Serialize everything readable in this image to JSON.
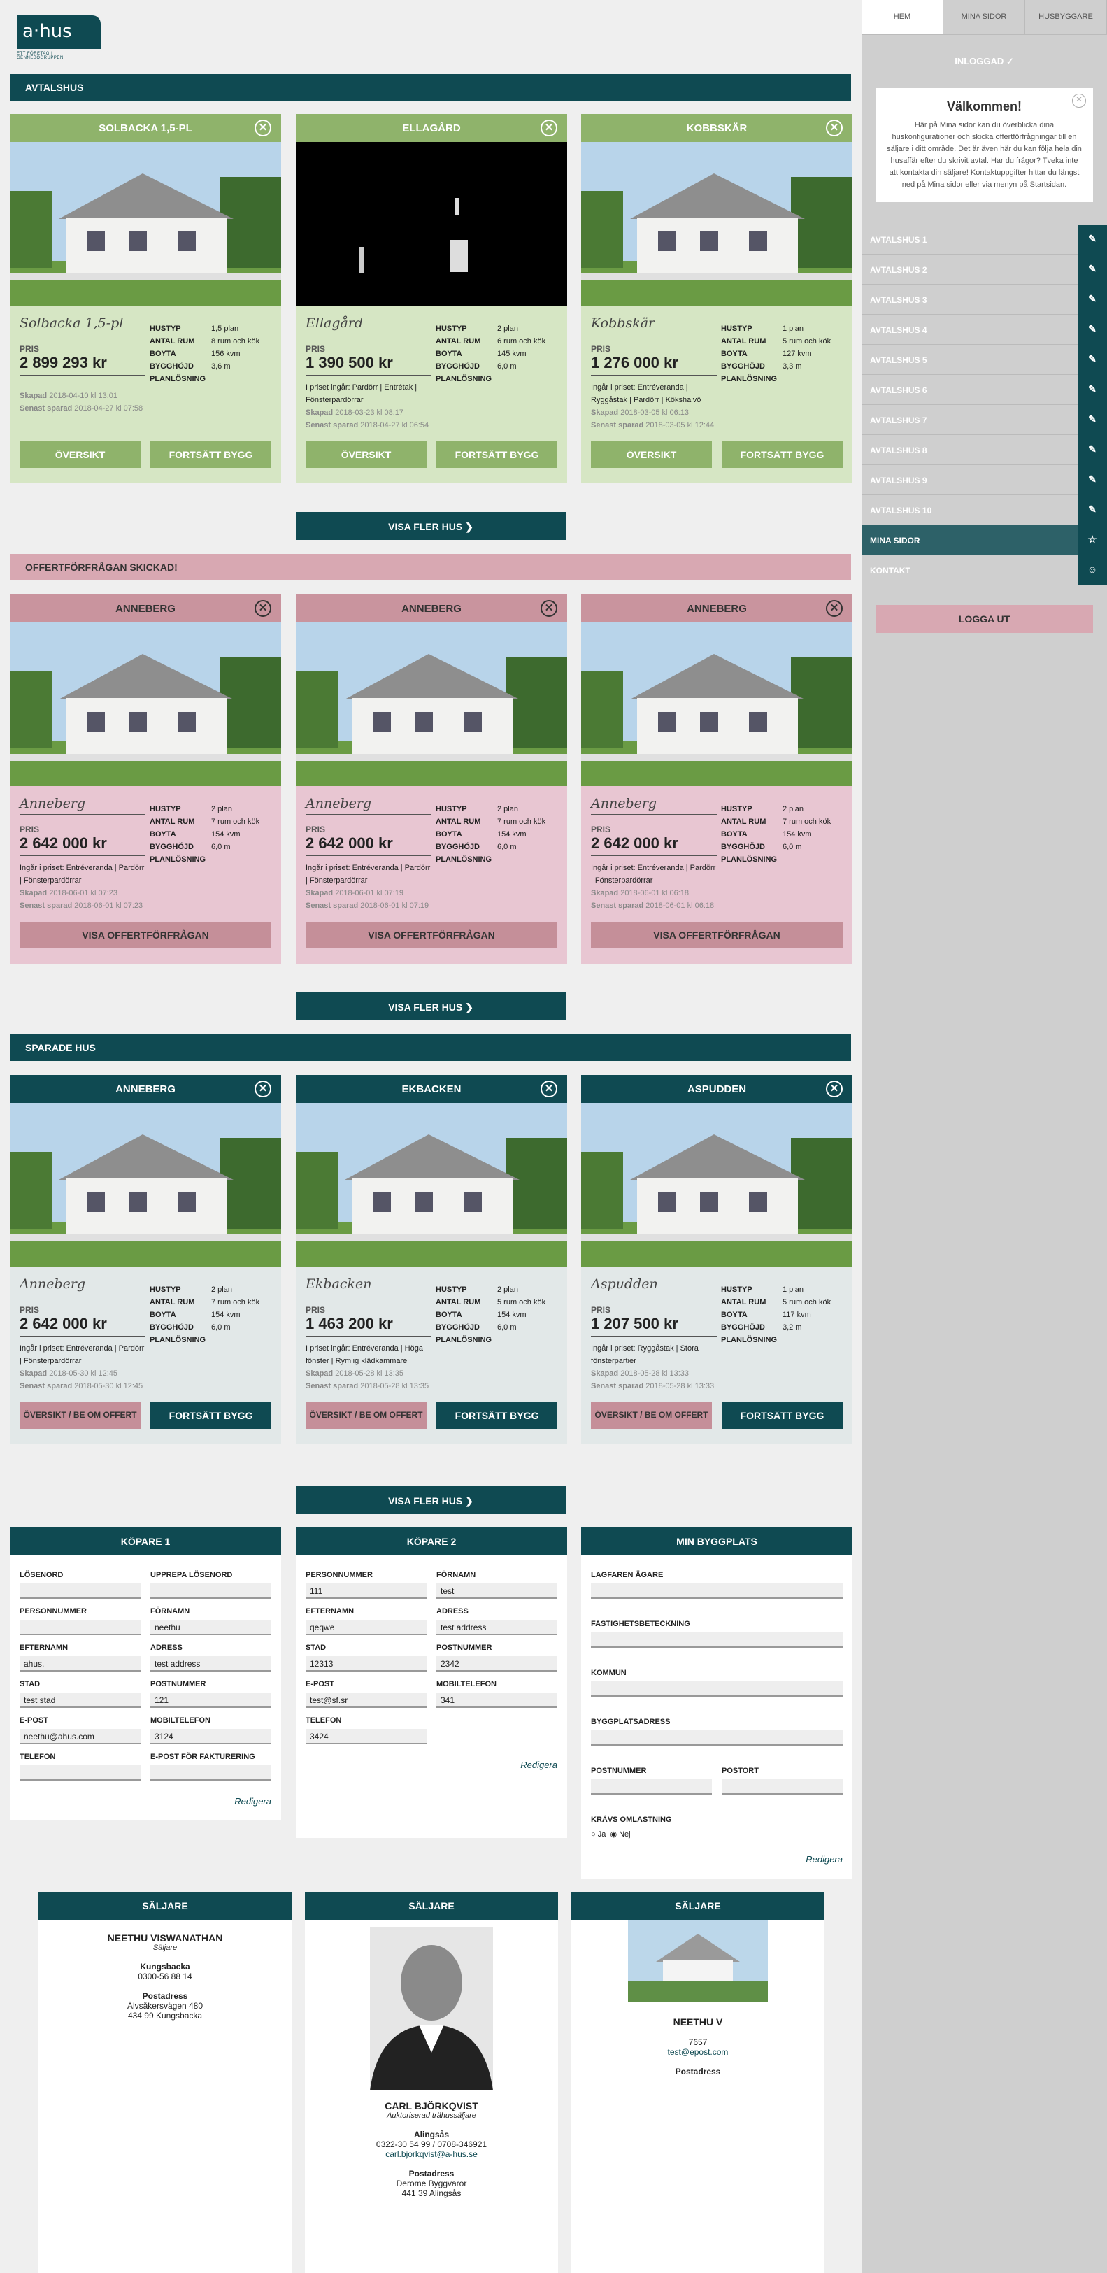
{
  "logo": {
    "brand": "a·hus",
    "tagline": "ETT FÖRETAG I GENNEBOGRUPPEN"
  },
  "sections": {
    "avtalshus": "AVTALSHUS",
    "offert": "OFFERTFÖRFRÅGAN SKICKAD!",
    "sparade": "SPARADE HUS",
    "more": "VISA FLER HUS ❯"
  },
  "labels": {
    "pris": "PRIS",
    "hustyp": "HUSTYP",
    "antal_rum": "ANTAL RUM",
    "boyta": "BOYTA",
    "bygghojd": "BYGGHÖJD",
    "planlosning": "PLANLÖSNING",
    "skapad": "Skapad",
    "senast": "Senast sparad"
  },
  "avtal": [
    {
      "title": "SOLBACKA 1,5-PL",
      "name": "Solbacka 1,5-pl",
      "price": "2 899 293 kr",
      "hustyp": "1,5 plan",
      "rum": "8 rum och kök",
      "boyta": "156 kvm",
      "hojd": "3,6 m",
      "incl": "",
      "skapad": "2018-04-10 kl 13:01",
      "senast": "2018-04-27 kl 07:58",
      "b1": "ÖVERSIKT",
      "b2": "FORTSÄTT BYGG"
    },
    {
      "title": "ELLAGÅRD",
      "name": "Ellagård",
      "price": "1 390 500 kr",
      "hustyp": "2 plan",
      "rum": "6 rum och kök",
      "boyta": "145 kvm",
      "hojd": "6,0 m",
      "incl": "I priset ingår: Pardörr | Entrétak | Fönsterpardörrar",
      "skapad": "2018-03-23 kl 08:17",
      "senast": "2018-04-27 kl 06:54",
      "b1": "ÖVERSIKT",
      "b2": "FORTSÄTT BYGG"
    },
    {
      "title": "KOBBSKÄR",
      "name": "Kobbskär",
      "price": "1 276 000 kr",
      "hustyp": "1 plan",
      "rum": "5 rum och kök",
      "boyta": "127 kvm",
      "hojd": "3,3 m",
      "incl": "Ingår i priset: Entréveranda | Ryggåstak | Pardörr | Kökshalvö",
      "skapad": "2018-03-05 kl 06:13",
      "senast": "2018-03-05 kl 12:44",
      "b1": "ÖVERSIKT",
      "b2": "FORTSÄTT BYGG"
    }
  ],
  "offert": [
    {
      "title": "ANNEBERG",
      "name": "Anneberg",
      "price": "2 642 000 kr",
      "hustyp": "2 plan",
      "rum": "7 rum och kök",
      "boyta": "154 kvm",
      "hojd": "6,0 m",
      "incl": "Ingår i priset: Entréveranda | Pardörr | Fönsterpardörrar",
      "skapad": "2018-06-01 kl 07:23",
      "senast": "2018-06-01 kl 07:23",
      "b1": "VISA OFFERTFÖRFRÅGAN"
    },
    {
      "title": "ANNEBERG",
      "name": "Anneberg",
      "price": "2 642 000 kr",
      "hustyp": "2 plan",
      "rum": "7 rum och kök",
      "boyta": "154 kvm",
      "hojd": "6,0 m",
      "incl": "Ingår i priset: Entréveranda | Pardörr | Fönsterpardörrar",
      "skapad": "2018-06-01 kl 07:19",
      "senast": "2018-06-01 kl 07:19",
      "b1": "VISA OFFERTFÖRFRÅGAN"
    },
    {
      "title": "ANNEBERG",
      "name": "Anneberg",
      "price": "2 642 000 kr",
      "hustyp": "2 plan",
      "rum": "7 rum och kök",
      "boyta": "154 kvm",
      "hojd": "6,0 m",
      "incl": "Ingår i priset: Entréveranda | Pardörr | Fönsterpardörrar",
      "skapad": "2018-06-01 kl 06:18",
      "senast": "2018-06-01 kl 06:18",
      "b1": "VISA OFFERTFÖRFRÅGAN"
    }
  ],
  "sparade": [
    {
      "title": "ANNEBERG",
      "name": "Anneberg",
      "price": "2 642 000 kr",
      "hustyp": "2 plan",
      "rum": "7 rum och kök",
      "boyta": "154 kvm",
      "hojd": "6,0 m",
      "incl": "Ingår i priset: Entréveranda | Pardörr | Fönsterpardörrar",
      "skapad": "2018-05-30 kl 12:45",
      "senast": "2018-05-30 kl 12:45",
      "b1": "ÖVERSIKT / BE OM OFFERT",
      "b2": "FORTSÄTT BYGG"
    },
    {
      "title": "EKBACKEN",
      "name": "Ekbacken",
      "price": "1 463 200 kr",
      "hustyp": "2 plan",
      "rum": "5 rum och kök",
      "boyta": "154 kvm",
      "hojd": "6,0 m",
      "incl": "I priset ingår: Entréveranda | Höga fönster | Rymlig klädkammare",
      "skapad": "2018-05-28 kl 13:35",
      "senast": "2018-05-28 kl 13:35",
      "b1": "ÖVERSIKT / BE OM OFFERT",
      "b2": "FORTSÄTT BYGG"
    },
    {
      "title": "ASPUDDEN",
      "name": "Aspudden",
      "price": "1 207 500 kr",
      "hustyp": "1 plan",
      "rum": "5 rum och kök",
      "boyta": "117 kvm",
      "hojd": "3,2 m",
      "incl": "Ingår i priset: Ryggåstak | Stora fönsterpartier",
      "skapad": "2018-05-28 kl 13:33",
      "senast": "2018-05-28 kl 13:33",
      "b1": "ÖVERSIKT / BE OM OFFERT",
      "b2": "FORTSÄTT BYGG"
    }
  ],
  "kopare1": {
    "title": "KÖPARE 1",
    "fields": [
      {
        "l": "LÖSENORD",
        "v": ""
      },
      {
        "l": "UPPREPA LÖSENORD",
        "v": ""
      },
      {
        "l": "PERSONNUMMER",
        "v": ""
      },
      {
        "l": "FÖRNAMN",
        "v": "neethu"
      },
      {
        "l": "EFTERNAMN",
        "v": "ahus."
      },
      {
        "l": "ADRESS",
        "v": "test address"
      },
      {
        "l": "STAD",
        "v": "test stad"
      },
      {
        "l": "POSTNUMMER",
        "v": "121"
      },
      {
        "l": "E-POST",
        "v": "neethu@ahus.com"
      },
      {
        "l": "MOBILTELEFON",
        "v": "3124"
      },
      {
        "l": "TELEFON",
        "v": ""
      },
      {
        "l": "E-POST FÖR FAKTURERING",
        "v": ""
      }
    ],
    "edit": "Redigera"
  },
  "kopare2": {
    "title": "KÖPARE 2",
    "fields": [
      {
        "l": "PERSONNUMMER",
        "v": "111"
      },
      {
        "l": "FÖRNAMN",
        "v": "test"
      },
      {
        "l": "EFTERNAMN",
        "v": "qeqwe"
      },
      {
        "l": "ADRESS",
        "v": "test address"
      },
      {
        "l": "STAD",
        "v": "12313"
      },
      {
        "l": "POSTNUMMER",
        "v": "2342"
      },
      {
        "l": "E-POST",
        "v": "test@sf.sr"
      },
      {
        "l": "MOBILTELEFON",
        "v": "341"
      },
      {
        "l": "TELEFON",
        "v": "3424"
      }
    ],
    "edit": "Redigera"
  },
  "byggplats": {
    "title": "MIN BYGGPLATS",
    "lagfaren": "LAGFAREN ÄGARE",
    "fastighet": "FASTIGHETSBETECKNING",
    "kommun": "KOMMUN",
    "adress": "BYGGPLATSADRESS",
    "postnr": "POSTNUMMER",
    "postort": "POSTORT",
    "omlast": "KRÄVS OMLASTNING",
    "ja": "Ja",
    "nej": "Nej",
    "edit": "Redigera"
  },
  "saljare": [
    {
      "h": "SÄLJARE",
      "name": "NEETHU VISWANATHAN",
      "role": "Säljare",
      "ort": "Kungsbacka",
      "tel": "0300-56 88 14",
      "pa": "Postadress",
      "p1": "Älvsåkersvägen 480",
      "p2": "434 99 Kungsbacka"
    },
    {
      "h": "SÄLJARE",
      "name": "CARL BJÖRKQVIST",
      "role": "Auktoriserad trähussäljare",
      "ort": "Alingsås",
      "tel": "0322-30 54 99 / 0708-346921",
      "mail": "carl.bjorkqvist@a-hus.se",
      "pa": "Postadress",
      "p1": "Derome Byggvaror",
      "p2": "441 39 Alingsås"
    },
    {
      "h": "SÄLJARE",
      "name": "NEETHU V",
      "tel": "7657",
      "mail": "test@epost.com",
      "pa": "Postadress"
    }
  ],
  "side": {
    "tabs": [
      "HEM",
      "MINA SIDOR",
      "HUSBYGGARE"
    ],
    "inloggad": "INLOGGAD ✓",
    "welcome_title": "Välkommen!",
    "welcome_text": "Här på Mina sidor kan du överblicka dina huskonfigurationer och skicka offertförfrågningar till en säljare i ditt område. Det är även här du kan följa hela din husaffär efter du skrivit avtal. Har du frågor? Tveka inte att kontakta din säljare! Kontaktuppgifter hittar du längst ned på Mina sidor eller via menyn på Startsidan.",
    "nav": [
      "AVTALSHUS 1",
      "AVTALSHUS 2",
      "AVTALSHUS 3",
      "AVTALSHUS 4",
      "AVTALSHUS 5",
      "AVTALSHUS 6",
      "AVTALSHUS 7",
      "AVTALSHUS 8",
      "AVTALSHUS 9",
      "AVTALSHUS 10",
      "MINA SIDOR",
      "KONTAKT"
    ],
    "logout": "LOGGA UT"
  }
}
